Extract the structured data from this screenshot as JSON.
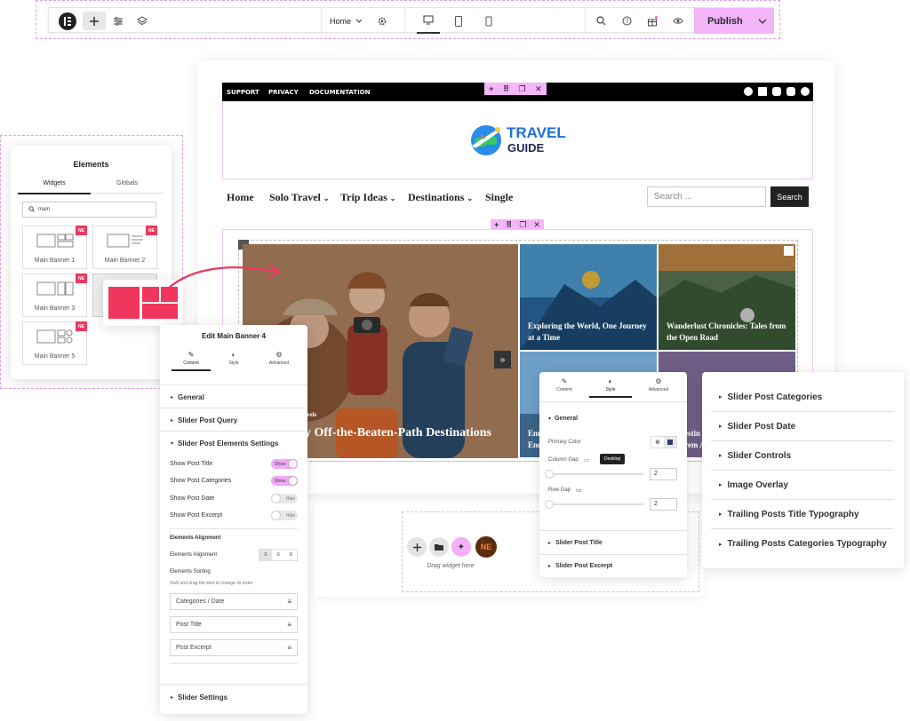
{
  "toolbar": {
    "page_label": "Home",
    "publish_label": "Publish"
  },
  "site": {
    "top_links": [
      "SUPPORT",
      "PRIVACY",
      "DOCUMENTATION"
    ],
    "logo_line1": "TRAVEL",
    "logo_line2": "GUIDE",
    "nav": [
      "Home",
      "Solo Travel",
      "Trip Ideas",
      "Destinations",
      "Single"
    ],
    "search_placeholder": "Search ...",
    "search_button": "Search",
    "slider_big_title": "y Off-the-Beaten-Path Destinations",
    "slider_big_category": "vels",
    "tile1_title": "Exploring the World, One Journey at a Time",
    "tile2_title": "Wanderlust Chronicles: Tales from the Open Road",
    "tile3_title": "Em... Enc...",
    "tile3_line1": "Em",
    "tile3_line2": "Enc",
    "tile4_line1": "estin",
    "tile4_line2": "rem A"
  },
  "elements_panel": {
    "title": "Elements",
    "tabs": [
      "Widgets",
      "Globals"
    ],
    "search_value": "main",
    "widgets": [
      "Main Banner 1",
      "Main Banner 2",
      "Main Banner 3",
      "Main Banner 5"
    ],
    "badge": "NE"
  },
  "edit_panel": {
    "title": "Edit Main Banner 4",
    "tabs": [
      "Content",
      "Style",
      "Advanced"
    ],
    "sections": [
      "General",
      "Slider Post Query",
      "Slider Post Elements Settings",
      "Slider Settings"
    ],
    "toggles": [
      {
        "label": "Show Post Title",
        "state": "Show"
      },
      {
        "label": "Show Post Categories",
        "state": "Show"
      },
      {
        "label": "Show Post Date",
        "state": "Hide"
      },
      {
        "label": "Show Post Excerpt",
        "state": "Hide"
      }
    ],
    "alignment_heading": "Elements Alignment",
    "alignment_label": "Elements Alignment",
    "sorting_label": "Elements Sorting",
    "sorting_hint": "Hold and drag the item to change its order",
    "sort_items": [
      "Categories / Date",
      "Post Title",
      "Post Excerpt"
    ]
  },
  "style_panel": {
    "tabs": [
      "Content",
      "Style",
      "Advanced"
    ],
    "section": "General",
    "primary_color": "Primary Color",
    "column_gap": "Column Gap",
    "tooltip": "Desktop",
    "column_gap_value": "2",
    "row_gap": "Row Gap",
    "row_gap_value": "2",
    "footer_sections": [
      "Slider Post Title",
      "Slider Post Excerpt"
    ]
  },
  "right_list": [
    "Slider Post Categories",
    "Slider Post Date",
    "Slider Controls",
    "Image Overlay",
    "Trailing Posts Title Typography",
    "Trailing Posts Categories Typography"
  ],
  "drag_zone": {
    "label": "Drag widget here"
  },
  "colors": {
    "accent_pink": "#f3b4f8",
    "badge_red": "#f0365d",
    "dark": "#000000"
  }
}
